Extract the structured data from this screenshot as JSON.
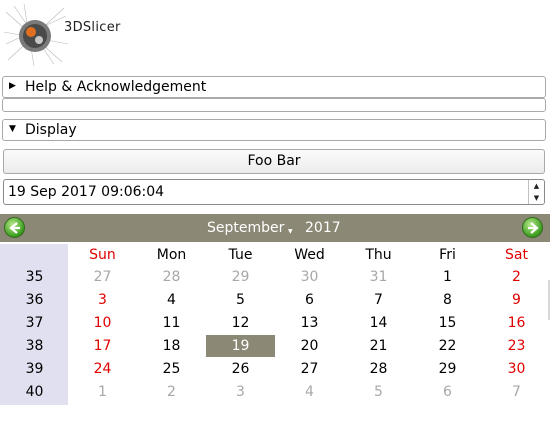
{
  "app": {
    "title": "3DSlicer"
  },
  "sections": {
    "help": {
      "label": "Help & Acknowledgement"
    },
    "display": {
      "label": "Display"
    }
  },
  "button": {
    "label": "Foo Bar"
  },
  "datetime": {
    "value": "19 Sep 2017 09:06:04"
  },
  "calendar": {
    "month": "September",
    "year": "2017",
    "weekdays": [
      "Sun",
      "Mon",
      "Tue",
      "Wed",
      "Thu",
      "Fri",
      "Sat"
    ],
    "weeks": [
      "35",
      "36",
      "37",
      "38",
      "39",
      "40"
    ],
    "days": [
      [
        "27",
        "28",
        "29",
        "30",
        "31",
        "1",
        "2"
      ],
      [
        "3",
        "4",
        "5",
        "6",
        "7",
        "8",
        "9"
      ],
      [
        "10",
        "11",
        "12",
        "13",
        "14",
        "15",
        "16"
      ],
      [
        "17",
        "18",
        "19",
        "20",
        "21",
        "22",
        "23"
      ],
      [
        "24",
        "25",
        "26",
        "27",
        "28",
        "29",
        "30"
      ],
      [
        "1",
        "2",
        "3",
        "4",
        "5",
        "6",
        "7"
      ]
    ],
    "selected": "19",
    "colors": {
      "weekend": "#e00000",
      "other_month": "#a8a8a8",
      "header": "#8b8876",
      "week_col": "#e0e0f0"
    }
  }
}
